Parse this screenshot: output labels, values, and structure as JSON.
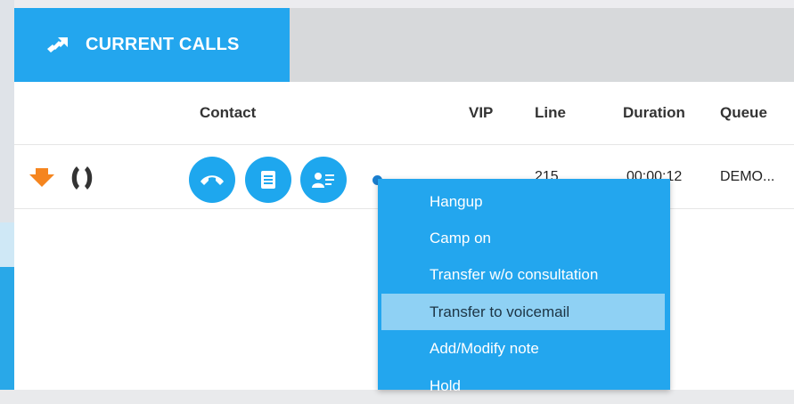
{
  "tab": {
    "label": "CURRENT CALLS",
    "icon": "phone-transfer-icon"
  },
  "columns": {
    "contact": "Contact",
    "vip": "VIP",
    "line": "Line",
    "duration": "Duration",
    "queue": "Queue"
  },
  "call": {
    "priority_icon": "arrow-down-icon",
    "status_icon": "phone-ringing-icon",
    "line": "215",
    "duration": "00:00:12",
    "queue": "DEMO..."
  },
  "actions": {
    "hangup_icon": "hangup-icon",
    "note_icon": "note-icon",
    "contact_icon": "contact-card-icon"
  },
  "colors": {
    "accent": "#23a6ee",
    "highlight": "#8fd1f4",
    "priority": "#f5851f"
  },
  "menu": {
    "items": [
      {
        "label": "Hangup"
      },
      {
        "label": "Camp on"
      },
      {
        "label": "Transfer w/o consultation"
      },
      {
        "label": "Transfer to voicemail"
      },
      {
        "label": "Add/Modify note"
      },
      {
        "label": "Hold"
      }
    ],
    "highlighted_index": 3
  }
}
